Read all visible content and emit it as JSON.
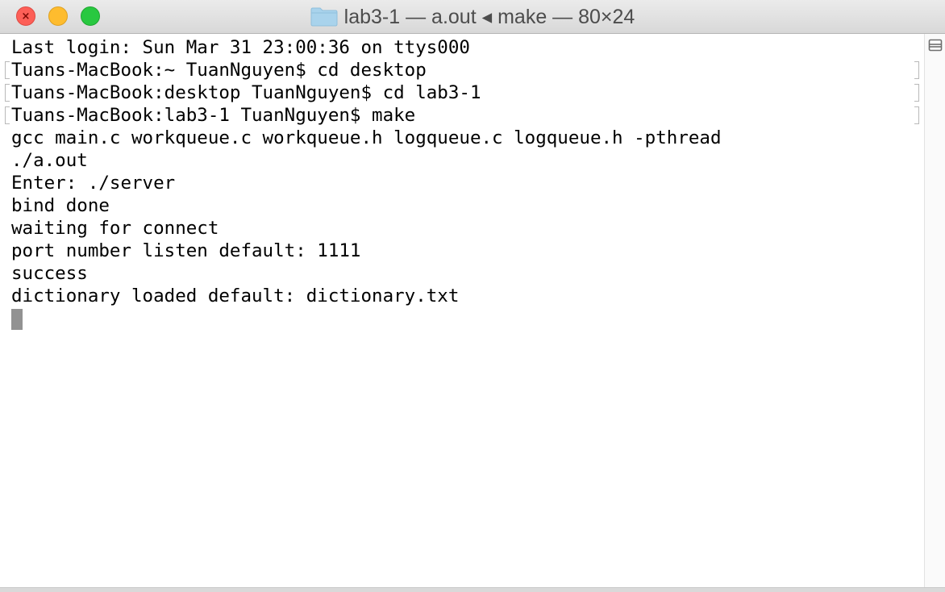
{
  "window": {
    "title": "lab3-1 — a.out ◂ make — 80×24",
    "icon": "folder-icon",
    "buttons": {
      "close": "close-button",
      "minimize": "minimize-button",
      "zoom": "zoom-button"
    }
  },
  "colors": {
    "close": "#fd5f57",
    "minimize": "#febc2e",
    "zoom": "#28c840",
    "folder": "#a9d3ec",
    "cursor": "#929292",
    "text": "#000000"
  },
  "terminal": {
    "lines": [
      "Last login: Sun Mar 31 23:00:36 on ttys000",
      "Tuans-MacBook:~ TuanNguyen$ cd desktop",
      "Tuans-MacBook:desktop TuanNguyen$ cd lab3-1",
      "Tuans-MacBook:lab3-1 TuanNguyen$ make",
      "gcc main.c workqueue.c workqueue.h logqueue.c logqueue.h -pthread",
      "./a.out",
      "Enter: ./server",
      "bind done",
      "waiting for connect",
      "port number listen default: 1111",
      "success",
      "dictionary loaded default: dictionary.txt"
    ]
  },
  "scrollbar": {
    "split_icon": "split-pane-icon"
  }
}
